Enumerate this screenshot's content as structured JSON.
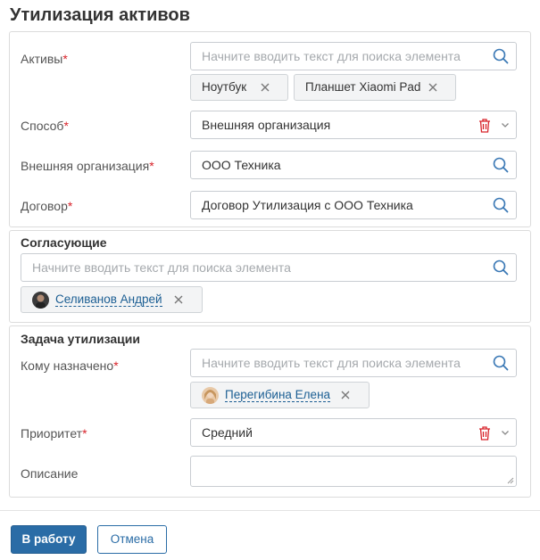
{
  "page_title": "Утилизация активов",
  "search_placeholder": "Начните вводить текст для поиска элемента",
  "assets": {
    "label": "Активы",
    "required_mark": "*",
    "tags": [
      "Ноутбук",
      "Планшет Xiaomi Pad"
    ]
  },
  "method": {
    "label": "Способ",
    "required_mark": "*",
    "value": "Внешняя организация"
  },
  "external_org": {
    "label": "Внешняя организация",
    "required_mark": "*",
    "value": "ООО Техника"
  },
  "contract": {
    "label": "Договор",
    "required_mark": "*",
    "value": "Договор Утилизация с ООО Техника"
  },
  "approvers": {
    "title": "Согласующие",
    "people": [
      "Селиванов Андрей"
    ]
  },
  "disposal_task": {
    "title": "Задача утилизации",
    "assignee_label": "Кому назначено",
    "assignee_required_mark": "*",
    "assignee": "Перегибина Елена",
    "priority_label": "Приоритет",
    "priority_required_mark": "*",
    "priority_value": "Средний",
    "description_label": "Описание"
  },
  "buttons": {
    "primary": "В работу",
    "cancel": "Отмена"
  },
  "colors": {
    "primary": "#2a6ca6",
    "required": "#d8232a",
    "link": "#1b5e93",
    "icon": "#3a78b5"
  },
  "icons": {
    "search": "search-icon",
    "remove": "close-icon",
    "delete": "trash-icon",
    "dropdown": "chevron-down-icon"
  }
}
